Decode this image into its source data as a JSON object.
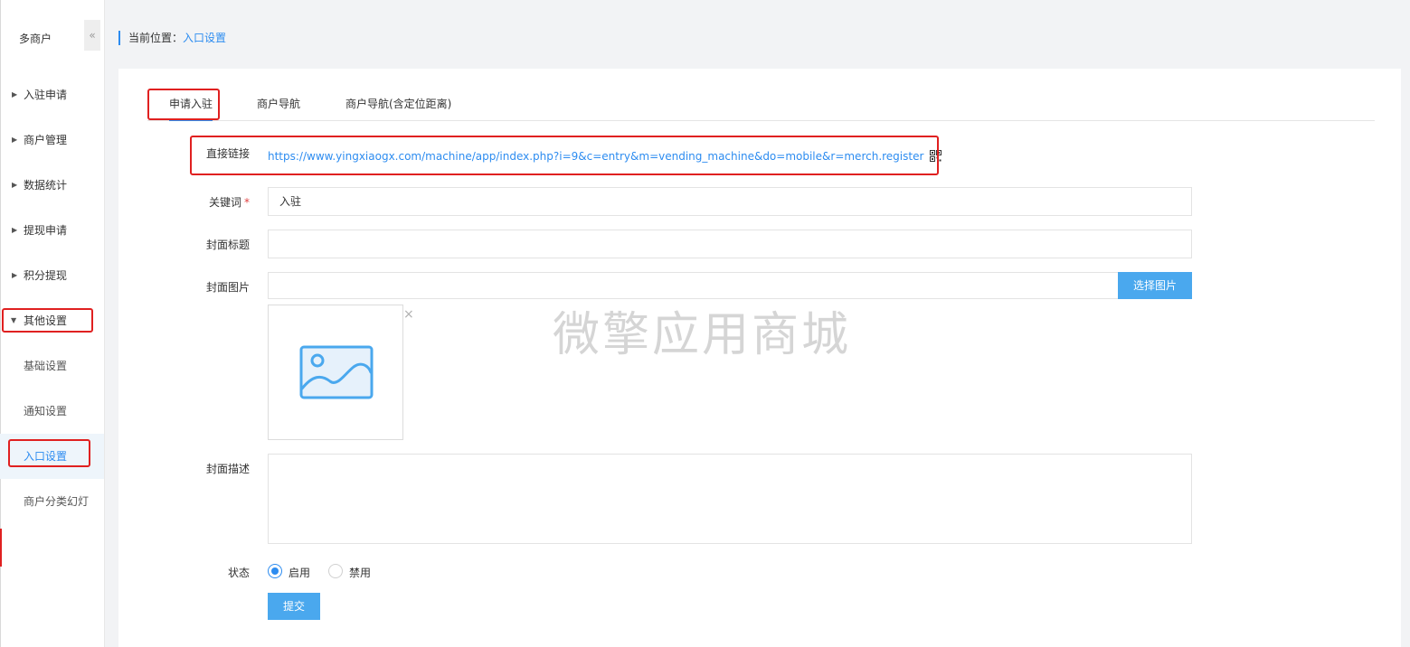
{
  "sidebar": {
    "title": "多商户",
    "collapse_icon": "«",
    "items": [
      {
        "label": "入驻申请"
      },
      {
        "label": "商户管理"
      },
      {
        "label": "数据统计"
      },
      {
        "label": "提现申请"
      },
      {
        "label": "积分提现"
      },
      {
        "label": "其他设置",
        "expanded": true
      }
    ],
    "subitems": [
      {
        "label": "基础设置"
      },
      {
        "label": "通知设置"
      },
      {
        "label": "入口设置",
        "active": true
      },
      {
        "label": "商户分类幻灯"
      }
    ]
  },
  "breadcrumb": {
    "prefix": "当前位置：",
    "current": "入口设置"
  },
  "tabs": [
    {
      "label": "申请入驻",
      "active": true
    },
    {
      "label": "商户导航"
    },
    {
      "label": "商户导航(含定位距离)"
    }
  ],
  "form": {
    "direct_link": {
      "label": "直接链接",
      "value": "https://www.yingxiaogx.com/machine/app/index.php?i=9&c=entry&m=vending_machine&do=mobile&r=merch.register"
    },
    "keyword": {
      "label": "关键词",
      "required_mark": "*",
      "value": "入驻"
    },
    "cover_title": {
      "label": "封面标题",
      "value": ""
    },
    "cover_image": {
      "label": "封面图片",
      "value": "",
      "button_label": "选择图片",
      "close_glyph": "×"
    },
    "cover_desc": {
      "label": "封面描述",
      "value": ""
    },
    "status": {
      "label": "状态",
      "options": [
        {
          "label": "启用",
          "checked": true
        },
        {
          "label": "禁用",
          "checked": false
        }
      ]
    },
    "submit_label": "提交"
  },
  "watermark": "微擎应用商城",
  "colors": {
    "accent": "#2d8cf0",
    "button": "#4aa8ee",
    "highlight": "#e02020"
  }
}
